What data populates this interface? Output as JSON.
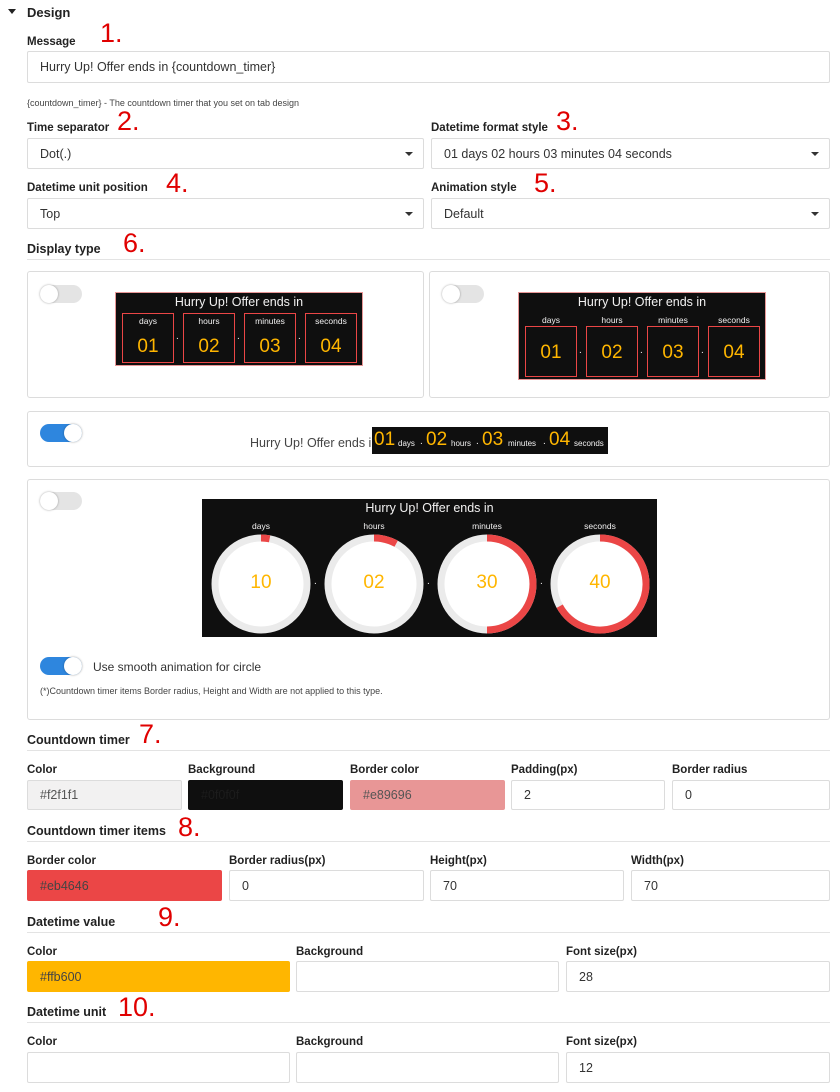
{
  "design": {
    "title": "Design",
    "message_label": "Message",
    "message_value": "Hurry Up! Offer ends in {countdown_timer}",
    "message_hint": "{countdown_timer} - The countdown timer that you set on tab design",
    "time_separator_label": "Time separator",
    "time_separator_value": "Dot(.)",
    "datetime_format_label": "Datetime format style",
    "datetime_format_value": "01 days 02 hours 03 minutes 04 seconds",
    "unit_position_label": "Datetime unit position",
    "unit_position_value": "Top",
    "animation_label": "Animation style",
    "animation_value": "Default",
    "display_type_label": "Display type"
  },
  "annotations": [
    "1.",
    "2.",
    "3.",
    "4.",
    "5.",
    "6.",
    "7.",
    "8.",
    "9.",
    "10."
  ],
  "preview": {
    "heading": "Hurry Up! Offer ends in",
    "units": [
      "days",
      "hours",
      "minutes",
      "seconds"
    ],
    "values": [
      "01",
      "02",
      "03",
      "04"
    ],
    "separator": ".",
    "inline_prefix": "Hurry Up! Offer ends in",
    "circle_values": [
      "10",
      "02",
      "30",
      "40"
    ],
    "circle_fill_fractions": [
      0.03,
      0.08,
      0.5,
      0.67
    ],
    "smooth_label": "Use smooth animation for circle",
    "circle_note": "(*)Countdown timer items Border radius, Height and Width are not applied to this type."
  },
  "countdown_timer": {
    "title": "Countdown timer",
    "color_label": "Color",
    "color_value": "#f2f1f1",
    "color_hex": "#f2f1f1",
    "background_label": "Background",
    "background_value": "#0f0f0f",
    "background_hex": "#0f0f0f",
    "border_color_label": "Border color",
    "border_color_value": "#e89696",
    "border_color_hex": "#e89696",
    "padding_label": "Padding(px)",
    "padding_value": "2",
    "border_radius_label": "Border radius",
    "border_radius_value": "0"
  },
  "countdown_items": {
    "title": "Countdown timer items",
    "border_color_label": "Border color",
    "border_color_value": "#eb4646",
    "border_color_hex": "#eb4646",
    "border_radius_label": "Border radius(px)",
    "border_radius_value": "0",
    "height_label": "Height(px)",
    "height_value": "70",
    "width_label": "Width(px)",
    "width_value": "70"
  },
  "datetime_value": {
    "title": "Datetime value",
    "color_label": "Color",
    "color_value": "#ffb600",
    "color_hex": "#ffb600",
    "background_label": "Background",
    "background_value": "",
    "font_size_label": "Font size(px)",
    "font_size_value": "28"
  },
  "datetime_unit": {
    "title": "Datetime unit",
    "color_label": "Color",
    "color_value": "",
    "background_label": "Background",
    "background_value": "",
    "font_size_label": "Font size(px)",
    "font_size_value": "12"
  },
  "colors": {
    "accent_blue": "#2e86de",
    "timer_value": "#ffb600",
    "timer_border": "#eb4646"
  }
}
